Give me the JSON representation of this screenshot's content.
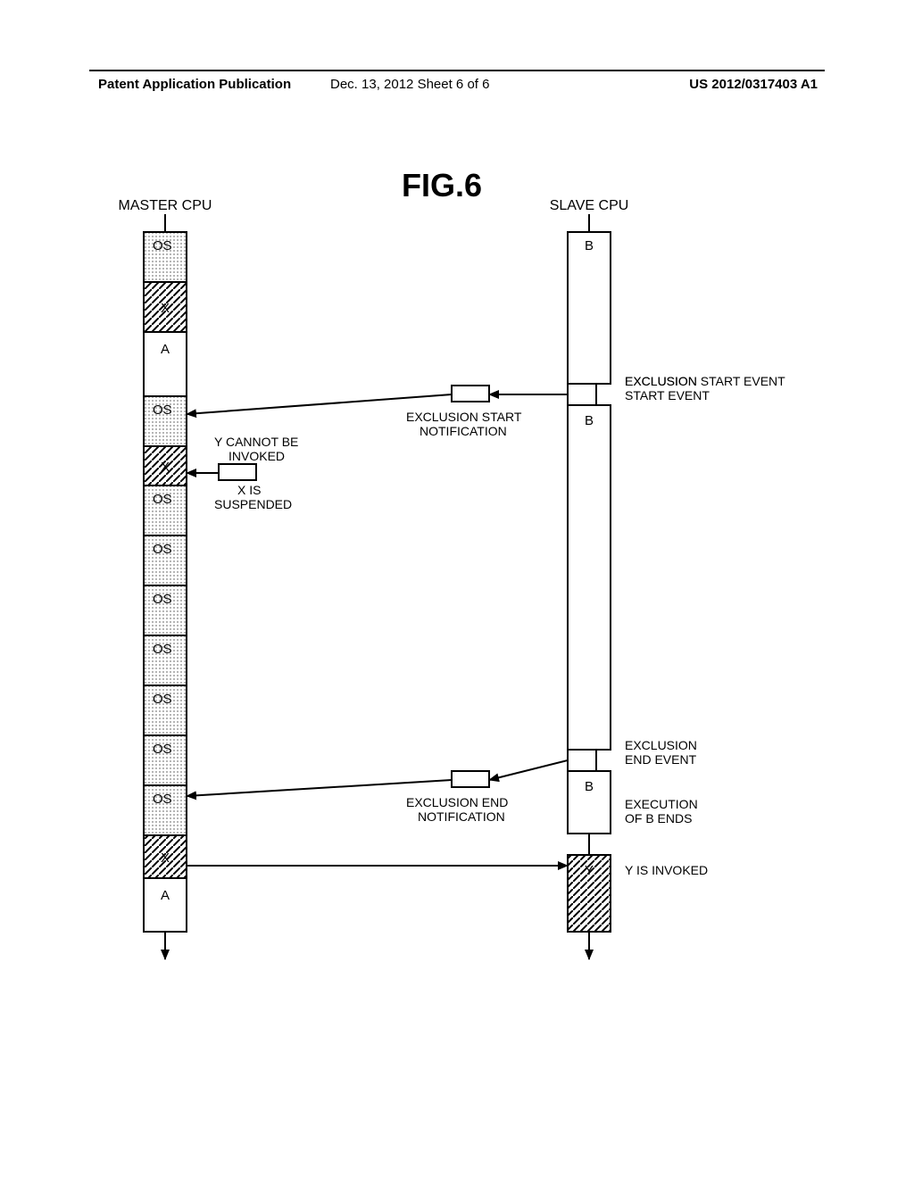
{
  "header": {
    "left": "Patent Application Publication",
    "mid": "Dec. 13, 2012   Sheet 6 of 6",
    "right": "US 2012/0317403 A1"
  },
  "fig": "FIG.6",
  "actors": {
    "master": "MASTER CPU",
    "slave": "SLAVE CPU"
  },
  "master_blocks": [
    "OS",
    "X",
    "A",
    "OS",
    "X",
    "OS",
    "OS",
    "OS",
    "OS",
    "OS",
    "OS",
    "OS",
    "X",
    "A"
  ],
  "slave_blocks": [
    "B",
    "B",
    "B",
    "Y"
  ],
  "annotations": {
    "exclusion_start_event": "EXCLUSION\nSTART EVENT",
    "exclusion_start_notif": "EXCLUSION START\nNOTIFICATION",
    "y_cannot": "Y CANNOT BE\nINVOKED",
    "x_susp": "X IS\nSUSPENDED",
    "exclusion_end_event": "EXCLUSION\nEND EVENT",
    "exclusion_end_notif": "EXCLUSION END\nNOTIFICATION",
    "exec_b_ends": "EXECUTION\nOF B ENDS",
    "y_invoked": "Y IS INVOKED"
  }
}
